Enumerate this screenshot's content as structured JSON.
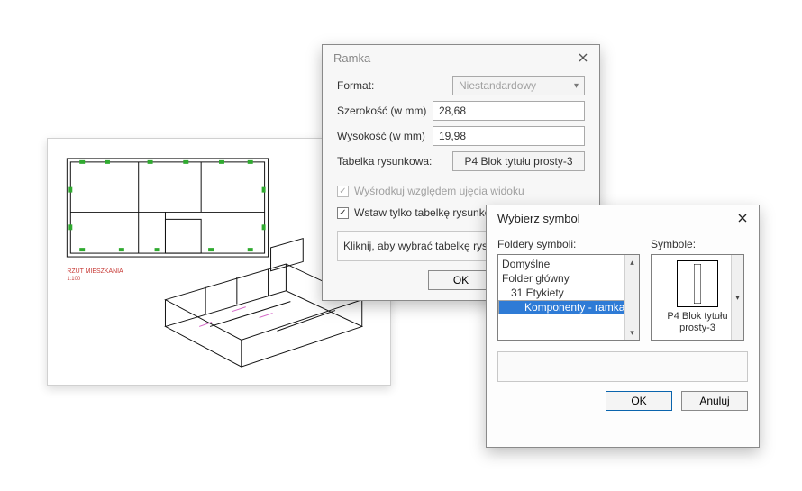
{
  "dialog_ramka": {
    "title": "Ramka",
    "labels": {
      "format": "Format:",
      "width": "Szerokość (w mm)",
      "height": "Wysokość (w mm)",
      "titleblock": "Tabelka rysunkowa:"
    },
    "format_value": "Niestandardowy",
    "width_value": "28,68",
    "height_value": "19,98",
    "titleblock_button": "P4 Blok tytułu prosty-3",
    "chk_center": "Wyśrodkuj względem ujęcia widoku",
    "chk_insert_only": "Wstaw tylko tabelkę rysunkową",
    "chk_center_checked": true,
    "chk_center_disabled": true,
    "chk_insert_checked": true,
    "hint": "Kliknij, aby wybrać tabelkę rysunkową.",
    "buttons": {
      "ok": "OK"
    }
  },
  "dialog_symbol": {
    "title": "Wybierz symbol",
    "folders_label": "Foldery symboli:",
    "symbols_label": "Symbole:",
    "tree": [
      {
        "label": "Domyślne",
        "indent": 0,
        "selected": false
      },
      {
        "label": "Folder główny",
        "indent": 0,
        "selected": false
      },
      {
        "label": "31 Etykiety",
        "indent": 1,
        "selected": false
      },
      {
        "label": "Komponenty - ramka",
        "indent": 2,
        "selected": true
      }
    ],
    "symbol_name": "P4 Blok tytułu prosty-3",
    "buttons": {
      "ok": "OK",
      "cancel": "Anuluj"
    }
  },
  "plan": {
    "caption1": "RZUT MIESZKANIA",
    "caption2": "1:100"
  }
}
